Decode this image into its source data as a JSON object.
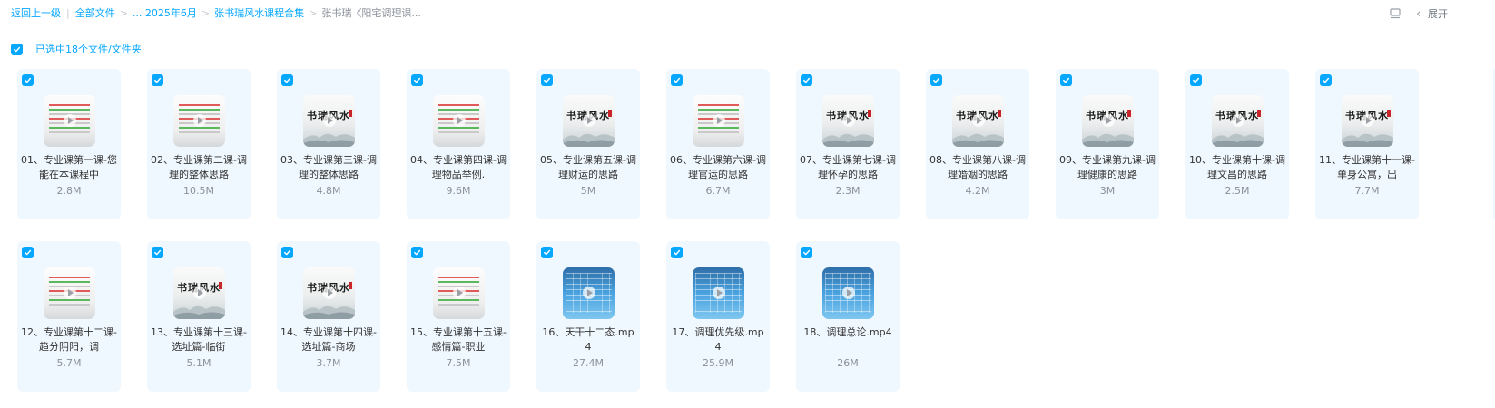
{
  "breadcrumb": {
    "back": "返回上一级",
    "all_files": "全部文件",
    "ellipsis_folder": "... 2025年6月",
    "course_folder": "张书瑞风水课程合集",
    "current_folder": "张书瑞《阳宅调理课..."
  },
  "toolbar": {
    "expand_label": "展开"
  },
  "selection": {
    "label": "已选中18个文件/文件夹"
  },
  "colors": {
    "accent": "#06a7ff",
    "card_bg": "#f0f8ff"
  },
  "files": [
    {
      "name": "01、专业课第一课-您能在本课程中",
      "size": "2.8M",
      "thumb": "doc"
    },
    {
      "name": "02、专业课第二课-调理的整体思路",
      "size": "10.5M",
      "thumb": "doc"
    },
    {
      "name": "03、专业课第三课-调理的整体思路",
      "size": "4.8M",
      "thumb": "brush"
    },
    {
      "name": "04、专业课第四课-调理物品举例.",
      "size": "9.6M",
      "thumb": "doc"
    },
    {
      "name": "05、专业课第五课-调理财运的思路",
      "size": "5M",
      "thumb": "brush"
    },
    {
      "name": "06、专业课第六课-调理官运的思路",
      "size": "6.7M",
      "thumb": "doc"
    },
    {
      "name": "07、专业课第七课-调理怀孕的思路",
      "size": "2.3M",
      "thumb": "brush"
    },
    {
      "name": "08、专业课第八课-调理婚姻的思路",
      "size": "4.2M",
      "thumb": "brush"
    },
    {
      "name": "09、专业课第九课-调理健康的思路",
      "size": "3M",
      "thumb": "brush"
    },
    {
      "name": "10、专业课第十课-调理文昌的思路",
      "size": "2.5M",
      "thumb": "brush"
    },
    {
      "name": "11、专业课第十一课-单身公寓，出",
      "size": "7.7M",
      "thumb": "brush"
    },
    {
      "name": "12、专业课第十二课-趋分阴阳，调",
      "size": "5.7M",
      "thumb": "doc"
    },
    {
      "name": "13、专业课第十三课-选址篇-临街",
      "size": "5.1M",
      "thumb": "brush"
    },
    {
      "name": "14、专业课第十四课-选址篇-商场",
      "size": "3.7M",
      "thumb": "brush"
    },
    {
      "name": "15、专业课第十五课-感情篇-职业",
      "size": "7.5M",
      "thumb": "doc"
    },
    {
      "name": "16、天干十二态.mp4",
      "size": "27.4M",
      "thumb": "screen"
    },
    {
      "name": "17、调理优先级.mp4",
      "size": "25.9M",
      "thumb": "screen"
    },
    {
      "name": "18、调理总论.mp4",
      "size": "26M",
      "thumb": "screen"
    }
  ],
  "thumb_text": {
    "brush": "书瑞风水"
  },
  "icons": {
    "view_toggle": "list-view-icon",
    "expand": "chevron-left-icon",
    "checkbox": "check-icon",
    "play": "play-icon"
  }
}
